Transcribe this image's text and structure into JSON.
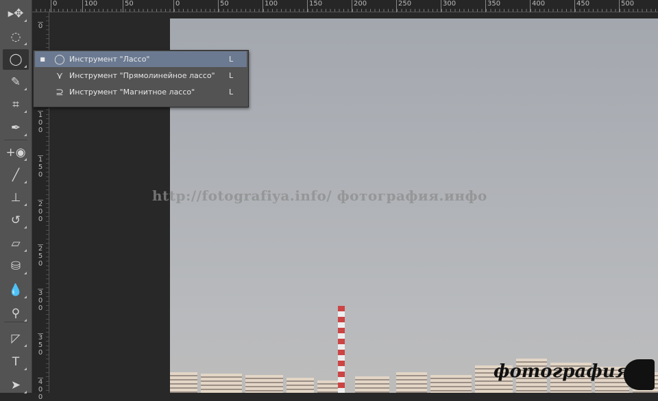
{
  "toolbar": {
    "tools": [
      {
        "name": "move",
        "glyph": "▸✥"
      },
      {
        "name": "marquee",
        "glyph": "◌"
      },
      {
        "name": "lasso",
        "glyph": "◯"
      },
      {
        "name": "quick-selection",
        "glyph": "✎"
      },
      {
        "name": "crop",
        "glyph": "⌗"
      },
      {
        "name": "eyedropper",
        "glyph": "✒"
      },
      {
        "name": "spot-healing",
        "glyph": "+◉"
      },
      {
        "name": "brush",
        "glyph": "╱"
      },
      {
        "name": "clone-stamp",
        "glyph": "⊥"
      },
      {
        "name": "history-brush",
        "glyph": "↺"
      },
      {
        "name": "eraser",
        "glyph": "▱"
      },
      {
        "name": "paint-bucket",
        "glyph": "⛁"
      },
      {
        "name": "blur",
        "glyph": "💧"
      },
      {
        "name": "dodge",
        "glyph": "⚲"
      },
      {
        "name": "pen",
        "glyph": "◸"
      },
      {
        "name": "type",
        "glyph": "T"
      },
      {
        "name": "path-selection",
        "glyph": "➤"
      }
    ]
  },
  "ruler": {
    "horizontal": [
      "0",
      "100",
      "50",
      "0",
      "50",
      "100",
      "150",
      "200",
      "250",
      "300",
      "350",
      "400",
      "450",
      "500"
    ],
    "vertical": [
      "0",
      "50",
      "100",
      "150",
      "200",
      "250",
      "300",
      "350",
      "400"
    ]
  },
  "flyout": {
    "items": [
      {
        "label": "Инструмент \"Лассо\"",
        "shortcut": "L",
        "selected": true,
        "bullet": "■",
        "icon": "◯"
      },
      {
        "label": "Инструмент \"Прямолинейное лассо\"",
        "shortcut": "L",
        "selected": false,
        "bullet": "",
        "icon": "⋎"
      },
      {
        "label": "Инструмент \"Магнитное лассо\"",
        "shortcut": "L",
        "selected": false,
        "bullet": "",
        "icon": "⊇"
      }
    ]
  },
  "watermark": "http://fotografiya.info/  фотография.инфо",
  "logo": "фотография",
  "colors": {
    "toolbar": "#535353",
    "workspace": "#282828",
    "selection": "#6b7a91"
  }
}
